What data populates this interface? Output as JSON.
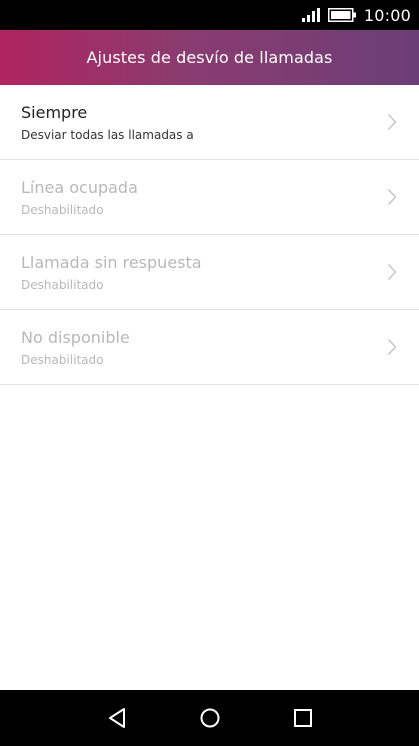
{
  "status_bar": {
    "time": "10:00",
    "icons": [
      "signal-icon",
      "battery-icon"
    ]
  },
  "header": {
    "title": "Ajustes de desvío de llamadas",
    "gradient_colors": [
      "#b0245f",
      "#8a3c70",
      "#6b3e78"
    ]
  },
  "list": {
    "items": [
      {
        "title": "Siempre",
        "subtitle": "Desviar todas las llamadas a",
        "enabled": true
      },
      {
        "title": "Línea ocupada",
        "subtitle": "Deshabilitado",
        "enabled": false
      },
      {
        "title": "Llamada sin respuesta",
        "subtitle": "Deshabilitado",
        "enabled": false
      },
      {
        "title": "No disponible",
        "subtitle": "Deshabilitado",
        "enabled": false
      }
    ],
    "chevron_icon": "chevron-right-icon"
  },
  "nav_bar": {
    "buttons": [
      "back-icon",
      "home-icon",
      "recents-icon"
    ]
  }
}
